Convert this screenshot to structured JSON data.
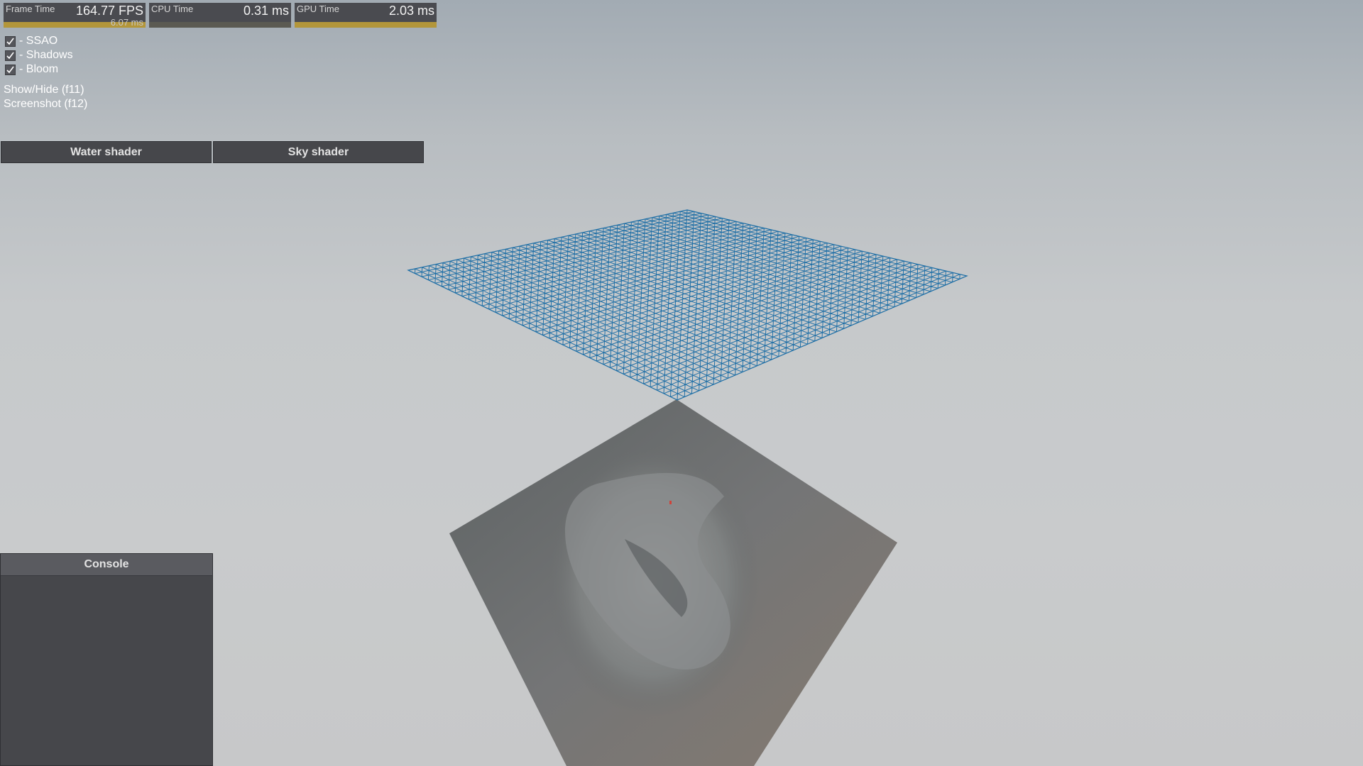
{
  "perf": {
    "frame": {
      "label": "Frame Time",
      "value": "164.77 FPS",
      "sub": "6.07 ms"
    },
    "cpu": {
      "label": "CPU Time",
      "value": "0.31 ms"
    },
    "gpu": {
      "label": "GPU Time",
      "value": "2.03 ms"
    }
  },
  "options": [
    {
      "label": "- SSAO",
      "checked": true
    },
    {
      "label": "- Shadows",
      "checked": true
    },
    {
      "label": "- Bloom",
      "checked": true
    }
  ],
  "hints": {
    "show_hide": "Show/Hide (f11)",
    "screenshot": "Screenshot (f12)"
  },
  "buttons": {
    "water": "Water shader",
    "sky": "Sky shader"
  },
  "console": {
    "title": "Console"
  },
  "colors": {
    "wireframe": "#1f6fa6",
    "panel": "#46474b",
    "graph": "#b3963a"
  }
}
